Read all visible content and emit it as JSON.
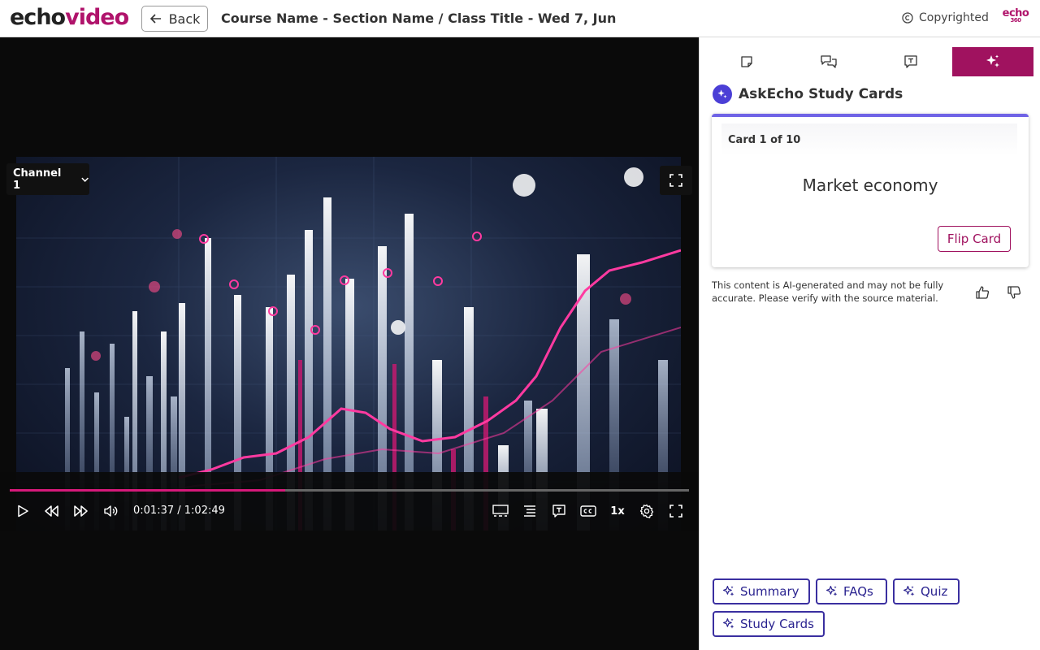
{
  "header": {
    "logo_part1": "echo",
    "logo_part2": "video",
    "back_label": "Back",
    "title": "Course Name - Section Name / Class Title - Wed 7, Jun",
    "copyright_label": "Copyrighted",
    "brand_mark": "echo",
    "brand_mark_sub": "360"
  },
  "player": {
    "channel_label": "Channel 1",
    "time_current": "0:01:37",
    "time_total": "1:02:49",
    "time_separator": " / ",
    "speed_label": "1x",
    "progress": 0.405,
    "accent": "#d6197a"
  },
  "side_panel": {
    "tabs": [
      {
        "icon": "notes-icon"
      },
      {
        "icon": "discussion-icon"
      },
      {
        "icon": "transcript-icon"
      },
      {
        "icon": "ai-sparkle-icon",
        "active": true
      }
    ],
    "title": "AskEcho Study Cards",
    "card": {
      "counter": "Card 1 of 10",
      "term": "Market economy",
      "flip_label": "Flip Card"
    },
    "disclaimer": "This content is AI-generated and may not be fully accurate. Please verify with the source material.",
    "chips": {
      "summary": "Summary",
      "faqs": "FAQs",
      "quiz": "Quiz",
      "study_cards": "Study Cards"
    },
    "accent": "#a0125f",
    "chip_color": "#3a2fa0"
  }
}
